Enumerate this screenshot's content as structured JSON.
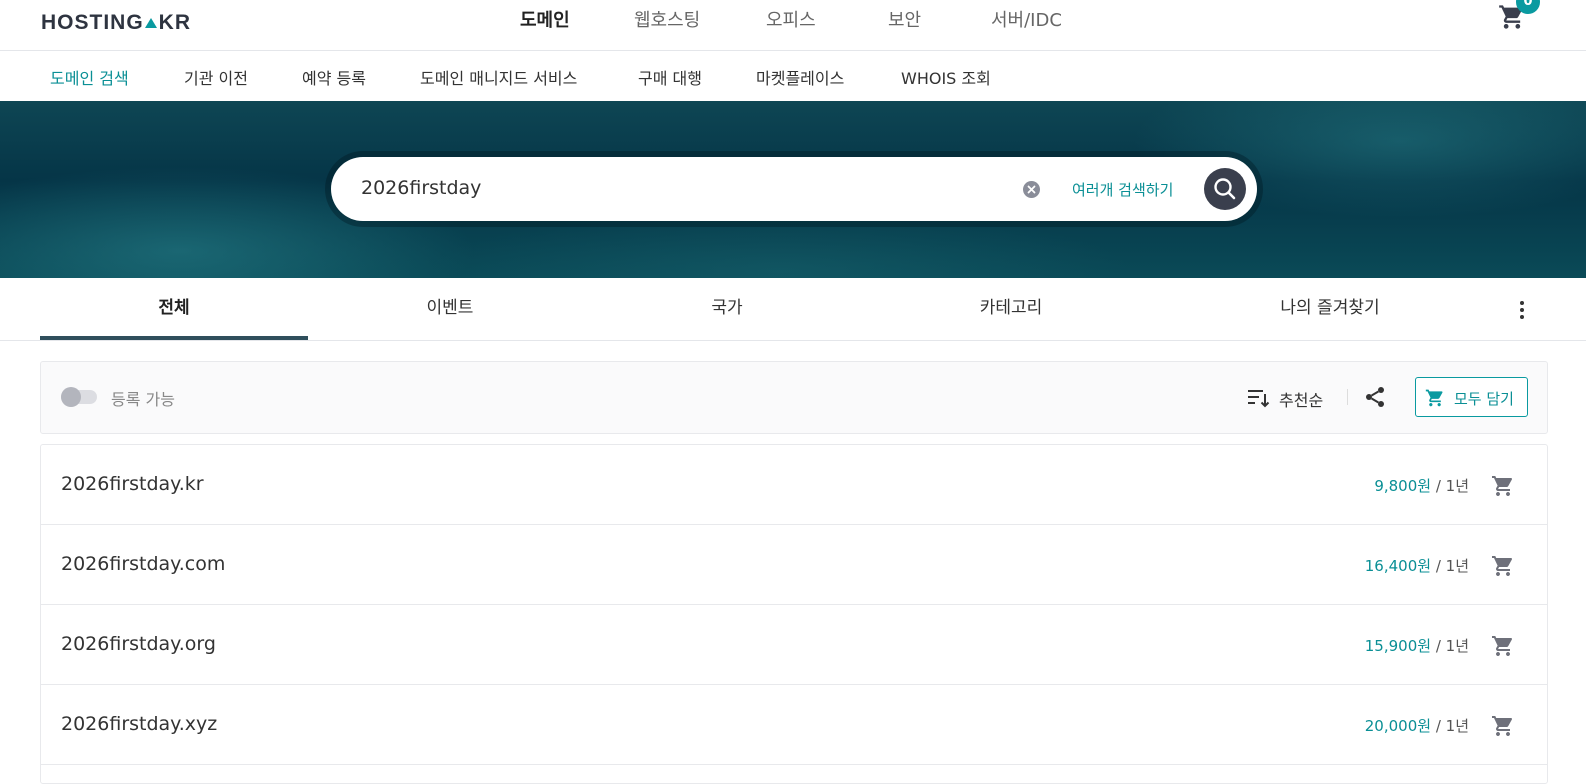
{
  "header": {
    "logo_left": "HOSTING",
    "logo_right": "KR",
    "nav": [
      "도메인",
      "웹호스팅",
      "오피스",
      "보안",
      "서버/IDC"
    ],
    "cart_count": "0"
  },
  "subnav": [
    "도메인 검색",
    "기관 이전",
    "예약 등록",
    "도메인 매니지드 서비스",
    "구매 대행",
    "마켓플레이스",
    "WHOIS 조회"
  ],
  "search": {
    "value": "2026firstday",
    "multi_search_label": "여러개 검색하기"
  },
  "tabs": [
    "전체",
    "이벤트",
    "국가",
    "카테고리",
    "나의 즐겨찾기"
  ],
  "filters": {
    "toggle_label": "등록 가능",
    "sort_label": "추천순",
    "add_all_label": "모두 담기"
  },
  "results": [
    {
      "domain": "2026firstday.kr",
      "price": "9,800원",
      "period": " / 1년"
    },
    {
      "domain": "2026firstday.com",
      "price": "16,400원",
      "period": " / 1년"
    },
    {
      "domain": "2026firstday.org",
      "price": "15,900원",
      "period": " / 1년"
    },
    {
      "domain": "2026firstday.xyz",
      "price": "20,000원",
      "period": " / 1년"
    }
  ],
  "colors": {
    "accent": "#0a9aa0",
    "hero_dark": "#053547",
    "search_button": "#3a3f4d"
  }
}
